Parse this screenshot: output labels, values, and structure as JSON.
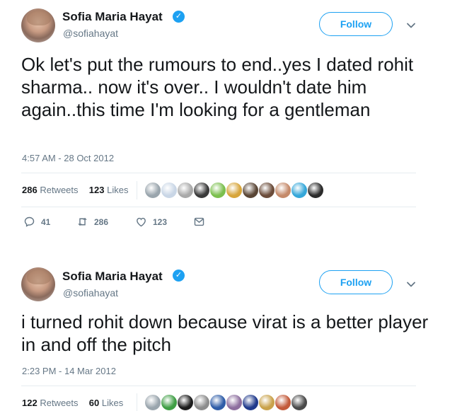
{
  "tweets": [
    {
      "name": "Sofia Maria Hayat",
      "handle": "@sofiahayat",
      "follow_label": "Follow",
      "text": "Ok let's put the rumours to end..yes I dated rohit sharma.. now it's over.. I wouldn't date him again..this time I'm looking for a gentleman",
      "timestamp": "4:57 AM - 28 Oct 2012",
      "retweets_count": "286",
      "retweets_label": "Retweets",
      "likes_count": "123",
      "likes_label": "Likes",
      "actions": {
        "replies": "41",
        "retweets": "286",
        "likes": "123"
      },
      "liker_colors": [
        "#9aa5ad",
        "#c9d6e6",
        "#a9a9a9",
        "#3a3a3a",
        "#7bbf4e",
        "#d7a53a",
        "#5a4636",
        "#6b4c3a",
        "#c58a6a",
        "#35a7d9",
        "#2b2b2b"
      ]
    },
    {
      "name": "Sofia Maria Hayat",
      "handle": "@sofiahayat",
      "follow_label": "Follow",
      "text": "i turned rohit down because virat is a better player in and off the pitch",
      "timestamp": "2:23 PM - 14 Mar 2012",
      "retweets_count": "122",
      "retweets_label": "Retweets",
      "likes_count": "60",
      "likes_label": "Likes",
      "liker_colors": [
        "#9aa5ad",
        "#3f9e45",
        "#1c1c1c",
        "#8c8c8c",
        "#2f5da8",
        "#8d6e9e",
        "#203a8c",
        "#c9a24a",
        "#c35a3a",
        "#4a4a4a"
      ]
    }
  ],
  "colors": {
    "accent": "#1da1f2",
    "secondary_text": "#657786",
    "divider": "#e6ecf0"
  },
  "icons": [
    "verified-badge-icon",
    "chevron-down-icon",
    "reply-icon",
    "retweet-icon",
    "like-icon",
    "message-icon"
  ]
}
